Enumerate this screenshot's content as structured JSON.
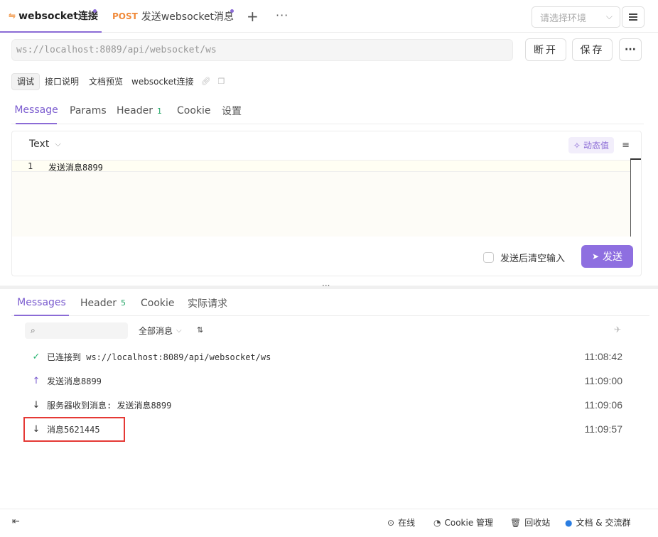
{
  "tabs": {
    "active": {
      "icon": "websocket-icon",
      "label": "websocket连接"
    },
    "second": {
      "method": "POST",
      "label": "发送websocket消息"
    },
    "add_icon": "plus-icon",
    "more_icon": "more-icon"
  },
  "env": {
    "placeholder": "请选择环境"
  },
  "url": {
    "value": "ws://localhost:8089/api/websocket/ws"
  },
  "buttons": {
    "disconnect": "断开",
    "save": "保存",
    "more": "···"
  },
  "subtabs": {
    "items": [
      "调试",
      "接口说明",
      "文档预览"
    ],
    "title": "websocket连接"
  },
  "message_tabs": {
    "message": "Message",
    "params": "Params",
    "header": "Header",
    "header_count": "1",
    "cookie": "Cookie",
    "settings": "设置"
  },
  "editor": {
    "format": "Text",
    "dynamic_value": "动态值",
    "line_number": "1",
    "content": "发送消息8899",
    "clear_after_send": "发送后清空输入",
    "send": "发送"
  },
  "result_tabs": {
    "messages": "Messages",
    "header": "Header",
    "header_count": "5",
    "cookie": "Cookie",
    "actual_request": "实际请求"
  },
  "filter": {
    "search_placeholder": "",
    "select": "全部消息"
  },
  "messages": [
    {
      "type": "connected",
      "text": "已连接到 ws://localhost:8089/api/websocket/ws",
      "time": "11:08:42"
    },
    {
      "type": "sent",
      "text": "发送消息8899",
      "time": "11:09:00"
    },
    {
      "type": "received",
      "text": "服务器收到消息: 发送消息8899",
      "time": "11:09:06"
    },
    {
      "type": "received",
      "text": "消息5621445",
      "time": "11:09:57"
    }
  ],
  "footer": {
    "online": "在线",
    "cookie_manage": "Cookie 管理",
    "recycle": "回收站",
    "docs_group": "文档 & 交流群"
  },
  "colors": {
    "accent": "#8b6bd6",
    "post": "#f08a3a",
    "success": "#2bb673",
    "highlight": "#e53935"
  }
}
